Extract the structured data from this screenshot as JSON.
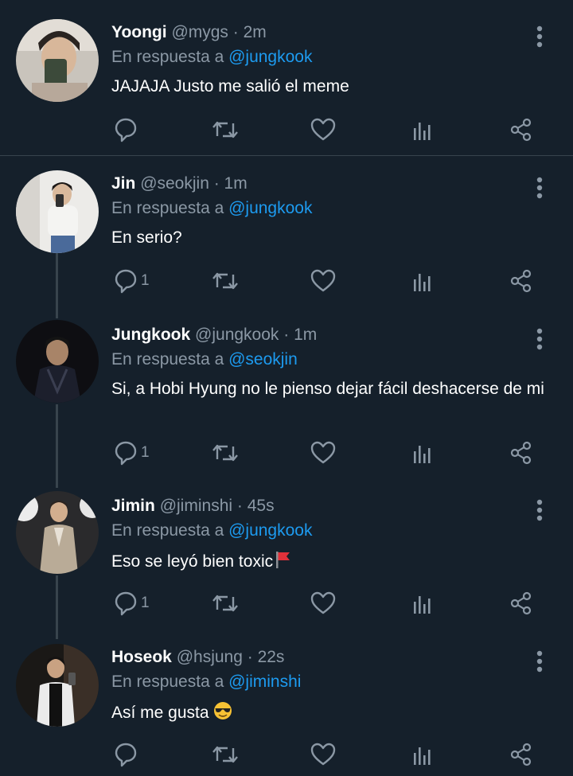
{
  "tweets": [
    {
      "name": "Yoongi",
      "handle": "@mygs",
      "sep": " · ",
      "time": "2m",
      "reply_prefix": "En respuesta a ",
      "reply_to": "@jungkook",
      "text": "JAJAJA Justo me salió el meme",
      "reply_count": ""
    },
    {
      "name": "Jin",
      "handle": "@seokjin",
      "sep": " · ",
      "time": "1m",
      "reply_prefix": "En respuesta a ",
      "reply_to": "@jungkook",
      "text": "En serio?",
      "reply_count": "1"
    },
    {
      "name": "Jungkook",
      "handle": "@jungkook",
      "sep": " · ",
      "time": "1m",
      "reply_prefix": "En respuesta a ",
      "reply_to": "@seokjin",
      "text": "Si, a Hobi Hyung no le pienso dejar fácil deshacerse de mi",
      "reply_count": "1"
    },
    {
      "name": "Jimin",
      "handle": "@jiminshi",
      "sep": " · ",
      "time": "45s",
      "reply_prefix": "En respuesta a ",
      "reply_to": "@jungkook",
      "text": "Eso se leyó bien toxic",
      "text_emoji": "red-flag",
      "reply_count": "1"
    },
    {
      "name": "Hoseok",
      "handle": "@hsjung",
      "sep": " · ",
      "time": "22s",
      "reply_prefix": "En respuesta a ",
      "reply_to": "@jiminshi",
      "text": "Así me gusta",
      "text_emoji": "sunglasses-face",
      "reply_count": ""
    }
  ],
  "colors": {
    "background": "#15202b",
    "secondary_text": "#8b98a5",
    "mention": "#1d9bf0",
    "divider": "#38444d"
  }
}
